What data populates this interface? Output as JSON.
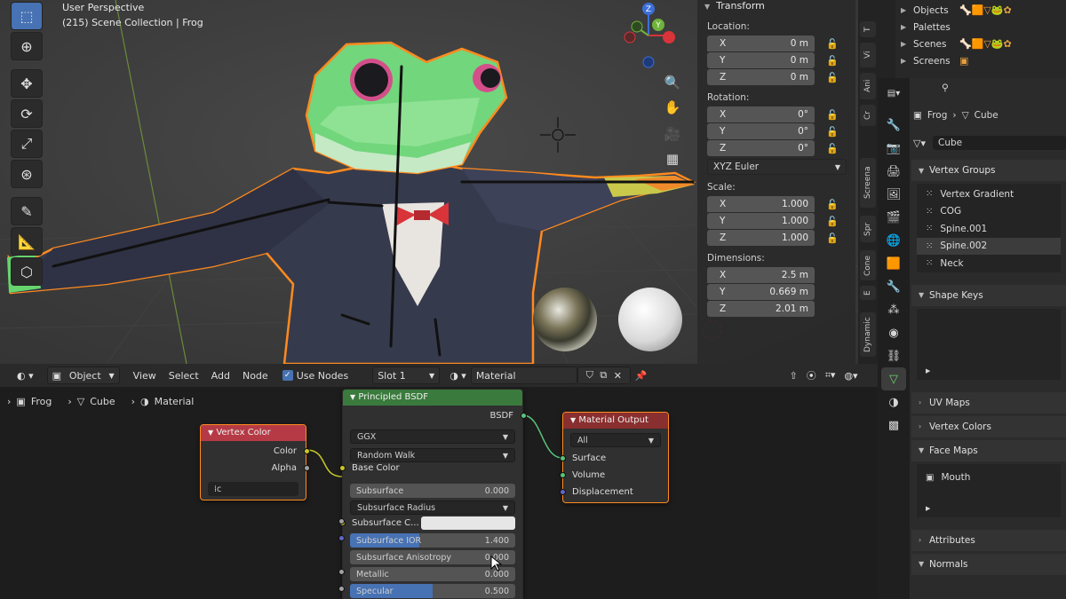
{
  "viewport": {
    "title": "User Perspective",
    "subtitle": "(215) Scene Collection | Frog",
    "gizmo": {
      "z_label": "Z",
      "y_label": "Y",
      "x_label": "X"
    }
  },
  "npanel": {
    "section": "Transform",
    "location_label": "Location:",
    "location": [
      {
        "axis": "X",
        "value": "0 m"
      },
      {
        "axis": "Y",
        "value": "0 m"
      },
      {
        "axis": "Z",
        "value": "0 m"
      }
    ],
    "rotation_label": "Rotation:",
    "rotation": [
      {
        "axis": "X",
        "value": "0°"
      },
      {
        "axis": "Y",
        "value": "0°"
      },
      {
        "axis": "Z",
        "value": "0°"
      }
    ],
    "rotation_mode": "XYZ Euler",
    "scale_label": "Scale:",
    "scale": [
      {
        "axis": "X",
        "value": "1.000"
      },
      {
        "axis": "Y",
        "value": "1.000"
      },
      {
        "axis": "Z",
        "value": "1.000"
      }
    ],
    "dimensions_label": "Dimensions:",
    "dimensions": [
      {
        "axis": "X",
        "value": "2.5 m"
      },
      {
        "axis": "Y",
        "value": "0.669 m"
      },
      {
        "axis": "Z",
        "value": "2.01 m"
      }
    ]
  },
  "vtabs": [
    "T",
    "Vi",
    "Ani",
    "Cr",
    "Screena",
    "Spr",
    "Cone",
    "E",
    "Dynamic"
  ],
  "node_header": {
    "mode": "Object",
    "menus": [
      "View",
      "Select",
      "Add",
      "Node"
    ],
    "use_nodes": "Use Nodes",
    "slot": "Slot 1",
    "material": "Material"
  },
  "breadcrumb": {
    "object": "Frog",
    "mesh": "Cube",
    "material": "Material"
  },
  "node_vertex_color": {
    "title": "Vertex Color",
    "outputs": [
      "Color",
      "Alpha"
    ]
  },
  "node_bsdf": {
    "title": "Principled BSDF",
    "output": "BSDF",
    "distribution": "GGX",
    "subsurface_method": "Random Walk",
    "base_color": "Base Color",
    "rows": [
      {
        "label": "Subsurface",
        "value": "0.000"
      },
      {
        "label": "Subsurface Radius",
        "value": ""
      },
      {
        "label": "Subsurface C...",
        "value": ""
      },
      {
        "label": "Subsurface IOR",
        "value": "1.400"
      },
      {
        "label": "Subsurface Anisotropy",
        "value": "0.000"
      },
      {
        "label": "Metallic",
        "value": "0.000"
      },
      {
        "label": "Specular",
        "value": "0.500"
      }
    ]
  },
  "node_output": {
    "title": "Material Output",
    "target": "All",
    "inputs": [
      "Surface",
      "Volume",
      "Displacement"
    ]
  },
  "outliner": [
    {
      "label": "Objects"
    },
    {
      "label": "Palettes"
    },
    {
      "label": "Scenes"
    },
    {
      "label": "Screens"
    }
  ],
  "properties": {
    "breadcrumb_object": "Frog",
    "breadcrumb_mesh": "Cube",
    "mesh_name": "Cube",
    "vertex_groups_title": "Vertex Groups",
    "vertex_groups": [
      "Vertex Gradient",
      "COG",
      "Spine.001",
      "Spine.002",
      "Neck"
    ],
    "shape_keys_title": "Shape Keys",
    "uv_maps_title": "UV Maps",
    "vertex_colors_title": "Vertex Colors",
    "face_maps_title": "Face Maps",
    "face_maps": [
      "Mouth"
    ],
    "attributes_title": "Attributes",
    "normals_title": "Normals"
  },
  "colors": {
    "accent_blue": "#4772b3",
    "selection_orange": "#ff8a1f",
    "frog_green": "#5fd66f",
    "bowtie_red": "#d8343a"
  }
}
